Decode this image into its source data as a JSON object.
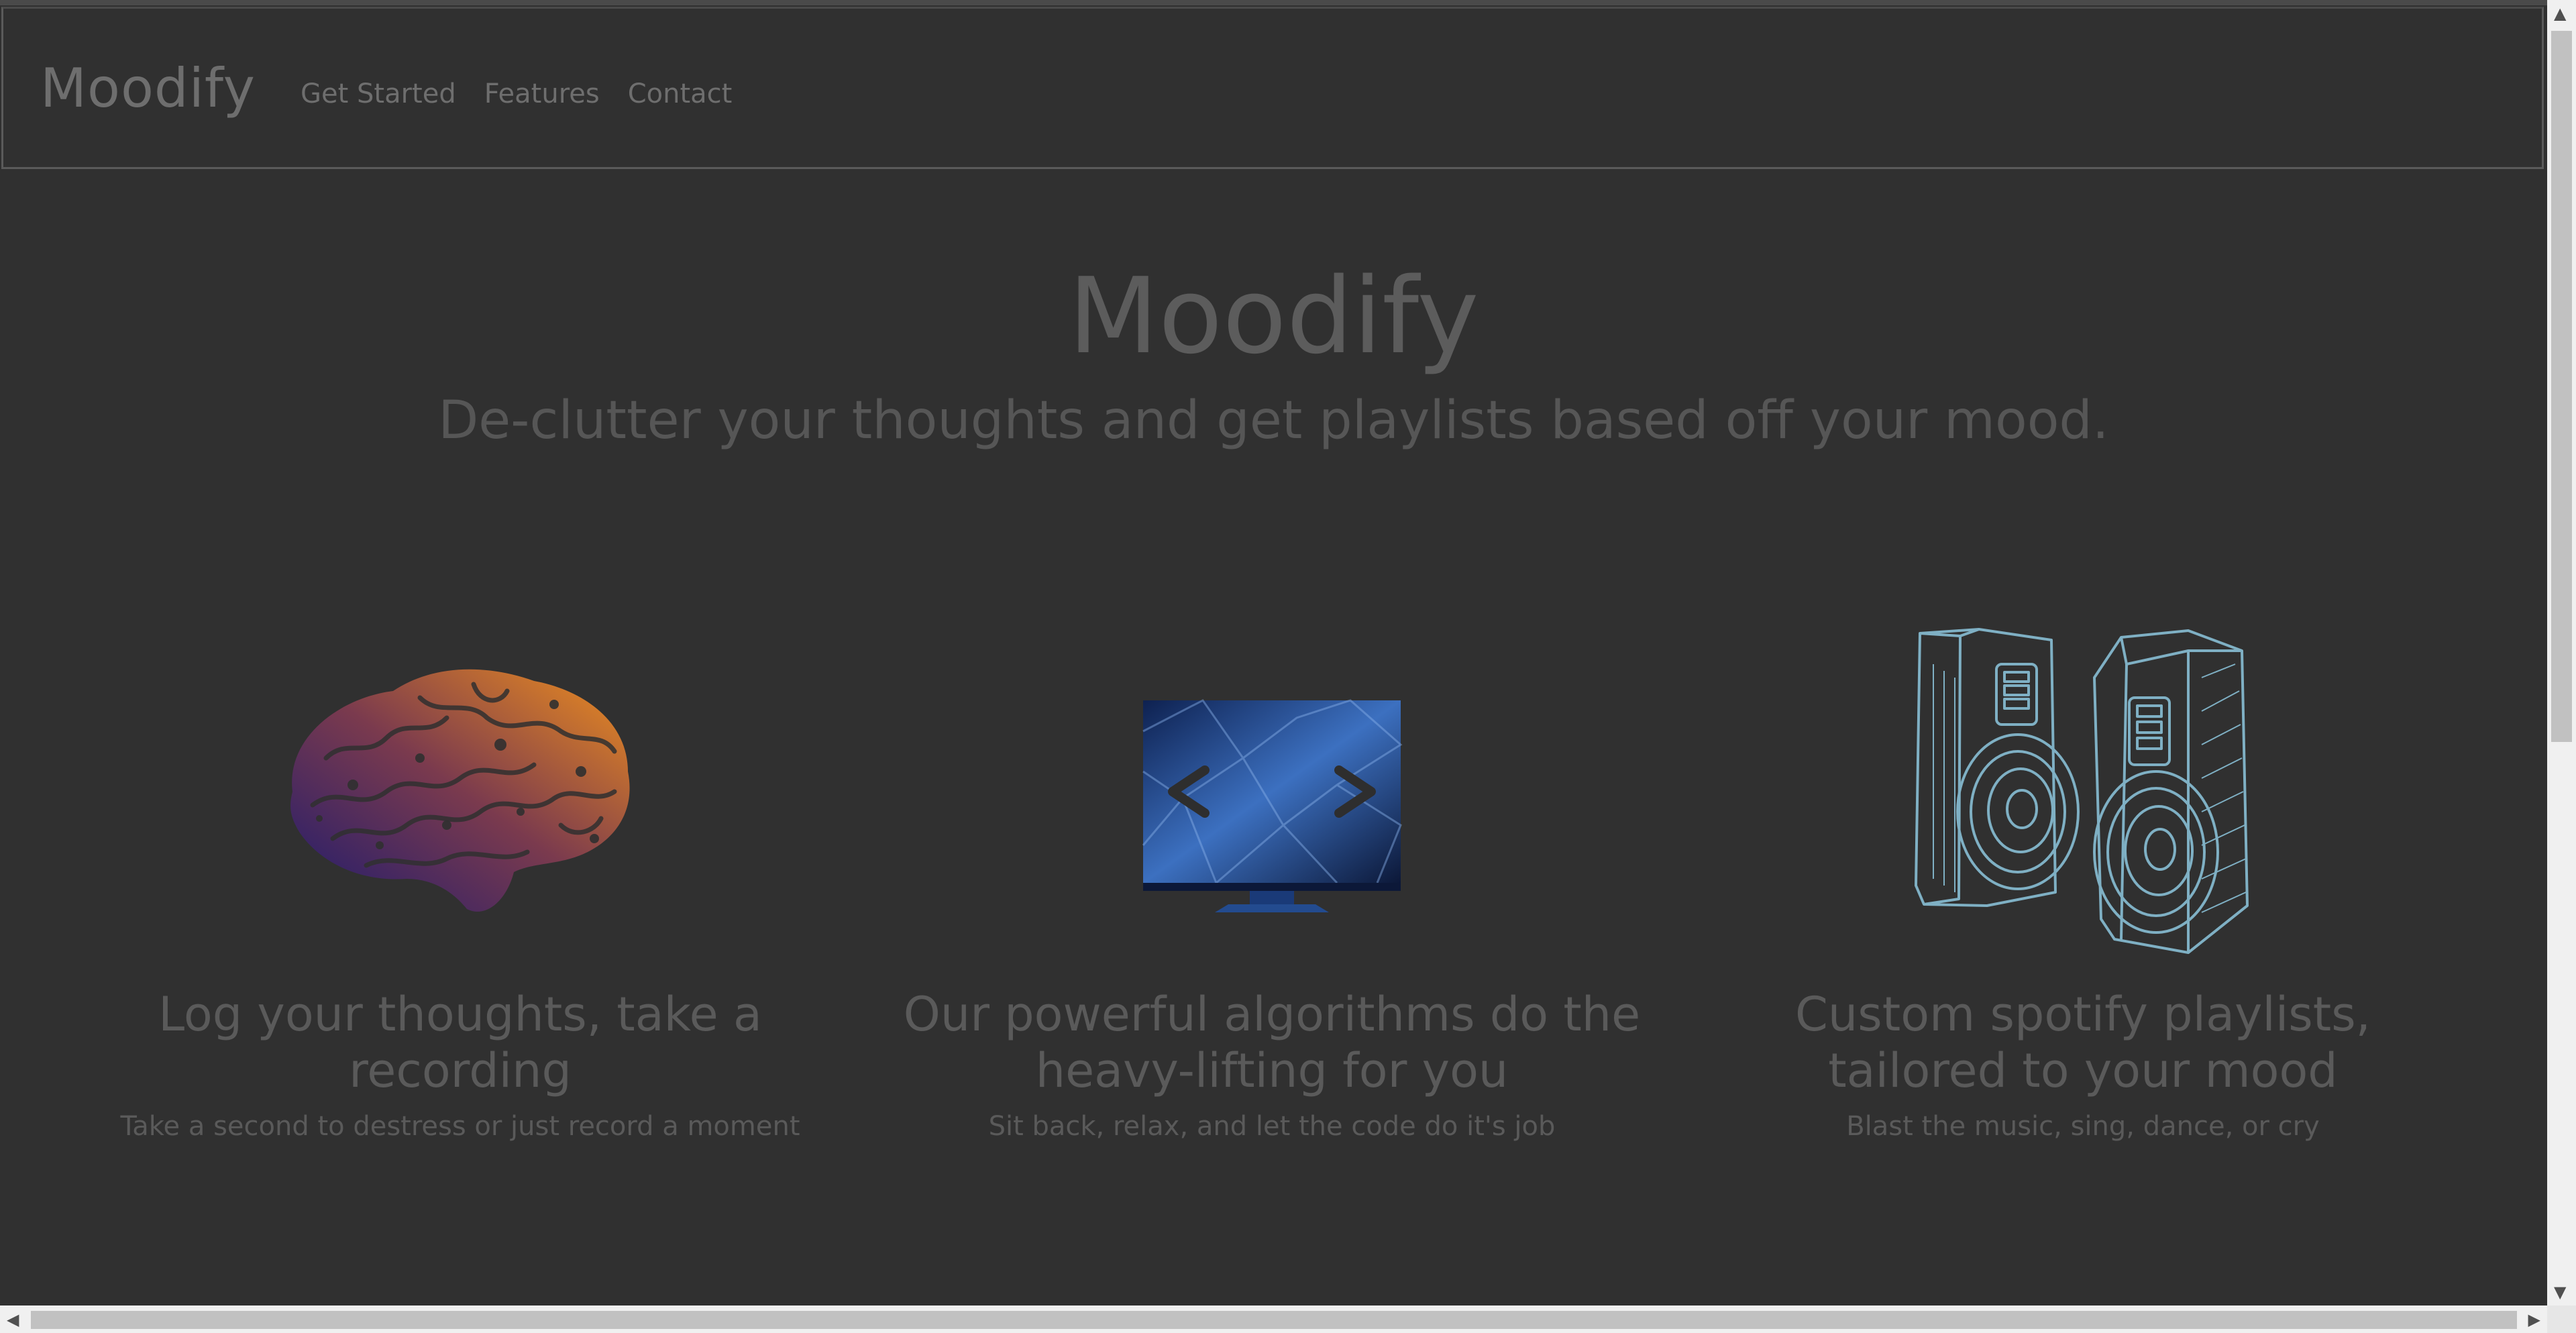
{
  "nav": {
    "brand": "Moodify",
    "links": [
      "Get Started",
      "Features",
      "Contact"
    ]
  },
  "hero": {
    "title": "Moodify",
    "subtitle": "De-clutter your thoughts and get playlists based off your mood."
  },
  "features": [
    {
      "icon": "brain-icon",
      "title_line1": "Log your thoughts, take a",
      "title_line2": "recording",
      "desc": "Take a second to destress or just record a moment"
    },
    {
      "icon": "monitor-code-icon",
      "title_line1": "Our powerful algorithms do the",
      "title_line2": "heavy-lifting for you",
      "desc": "Sit back, relax, and let the code do it's job"
    },
    {
      "icon": "speakers-icon",
      "title_line1": "Custom spotify playlists,",
      "title_line2": "tailored to your mood",
      "desc": "Blast the music, sing, dance, or cry"
    }
  ],
  "colors": {
    "background": "#303030",
    "text_muted": "#6e6e6e",
    "brain_gradient_start": "#1c1a6e",
    "brain_gradient_end": "#f0901e",
    "monitor_blue": "#3a6bb0",
    "speaker_outline": "#7fb0c4"
  }
}
